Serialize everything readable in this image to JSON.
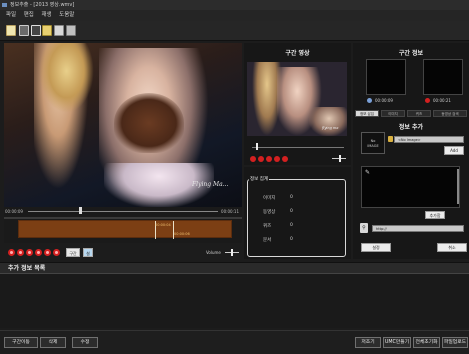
{
  "window": {
    "title": "정보추출 - [2013 영상.wmv]"
  },
  "menu": [
    "파일",
    "편집",
    "재생",
    "도움말"
  ],
  "toolbar": {
    "icons": [
      "new-file-icon",
      "open-folder-icon",
      "film-icon",
      "image-icon",
      "movie-icon",
      "settings-icon"
    ]
  },
  "video": {
    "signature": "Flying Ma..."
  },
  "timeline": {
    "start_time": "00:00:09",
    "end_time": "00:00:11",
    "segment_start_label": "00:00:04",
    "segment_end_label": "00:00:06"
  },
  "controls": {
    "loop_label": "구간",
    "ok_label": "설",
    "volume_label": "Volume"
  },
  "section_video": {
    "title": "구간 영상",
    "signature": "flying ma"
  },
  "summary": {
    "title": "정보 집계",
    "rows": [
      {
        "label": "이미지",
        "value": "0"
      },
      {
        "label": "동영상",
        "value": "0"
      },
      {
        "label": "퀴즈",
        "value": "0"
      },
      {
        "label": "문서",
        "value": "0"
      }
    ]
  },
  "section_info": {
    "title": "구간 정보",
    "start_time": "00:00:09",
    "end_time": "00:00:21",
    "tabs": [
      "정보 삽입",
      "이미지",
      "퀴즈",
      "동영상 검색"
    ],
    "add_title": "정보 추가",
    "no_image": [
      "No",
      "IMAGE"
    ],
    "image_select": "<No Image>",
    "add_label": "Add",
    "add_label2": "추가함",
    "url_placeholder": "http://",
    "apply_label": "설정",
    "cancel_label": "취소"
  },
  "info_list": {
    "title": "추가 정보 목록"
  },
  "bottom": {
    "left_buttons": [
      "구간이동",
      "삭제",
      "수정"
    ],
    "right_buttons": [
      "저조기",
      "UMC만들기",
      "전체초기화",
      "파일업로드"
    ]
  },
  "colors": {
    "accent_red": "#d42020",
    "segment_band": "#7c3f14",
    "panel": "#171717"
  }
}
